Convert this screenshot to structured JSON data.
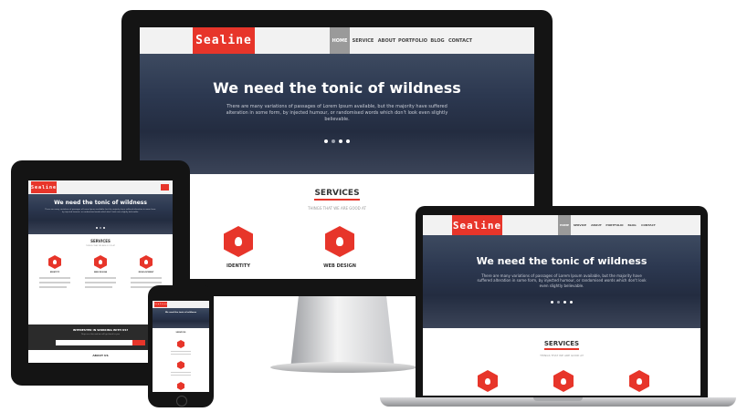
{
  "site": {
    "logo": "Sealine",
    "nav": [
      "HOME",
      "SERVICE",
      "ABOUT",
      "PORTFOLIO",
      "BLOG",
      "CONTACT"
    ],
    "hero_title": "We need the tonic of wildness",
    "hero_text": "There are many variations of passages of Lorem Ipsum available, but the majority have suffered alteration in some form, by injected humour, or randomised words which don't look even slightly believable.",
    "services_title": "SERVICES",
    "services_subtitle": "THINGS THAT WE ARE GOOD AT",
    "services": [
      "IDENTITY",
      "WEB DESIGN",
      "DEVELOPMENT"
    ],
    "contact_title": "INTERESTED IN WORKING WITH US?",
    "contact_text": "Drop us a line and we will get back to you",
    "about_title": "ABOUT US"
  },
  "colors": {
    "brand": "#e7352a",
    "frame": "#141414",
    "hero_dark": "#2c3850"
  },
  "icons": {
    "service_icon": "lightbulb-icon"
  }
}
